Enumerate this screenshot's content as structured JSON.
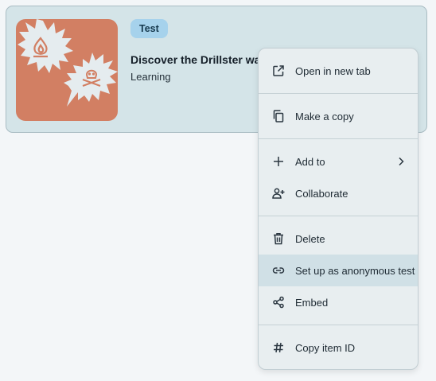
{
  "card": {
    "badge": "Test",
    "title": "Discover the Drillster way",
    "subtitle": "Learning",
    "thumbnail_icons": [
      "flame-icon",
      "skull-crossbones-icon"
    ],
    "thumbnail_color": "#d27f63"
  },
  "menu": {
    "items": [
      {
        "label": "Open in new tab",
        "icon": "open-new-tab-icon"
      },
      {
        "label": "Make a copy",
        "icon": "copy-icon"
      },
      {
        "label": "Add to",
        "icon": "plus-icon",
        "submenu": true
      },
      {
        "label": "Collaborate",
        "icon": "add-person-icon"
      },
      {
        "label": "Delete",
        "icon": "trash-icon"
      },
      {
        "label": "Set up as anonymous test",
        "icon": "link-icon",
        "highlighted": true
      },
      {
        "label": "Embed",
        "icon": "share-icon"
      },
      {
        "label": "Copy item ID",
        "icon": "hash-icon"
      }
    ]
  },
  "colors": {
    "card_background": "#d4e4e8",
    "badge_background": "#a6d2ec",
    "menu_background": "#e8eef0",
    "menu_highlight": "#d0e0e6"
  }
}
